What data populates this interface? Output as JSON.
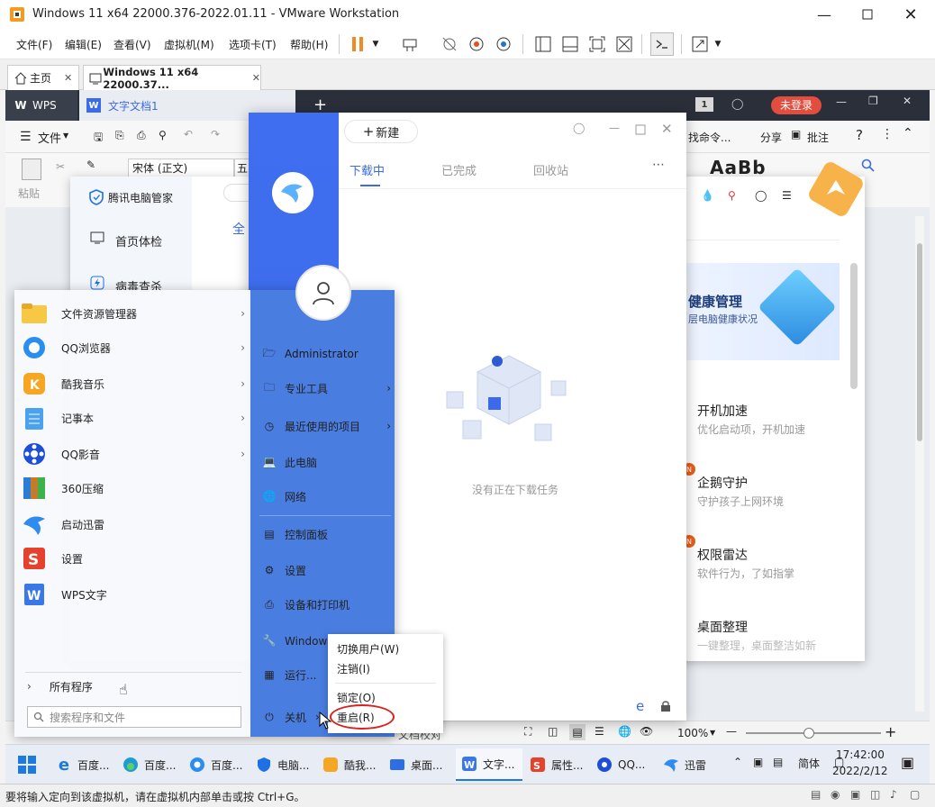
{
  "vmware": {
    "title": "Windows 11 x64 22000.376-2022.01.11 - VMware Workstation",
    "menu": [
      "文件(F)",
      "编辑(E)",
      "查看(V)",
      "虚拟机(M)",
      "选项卡(T)",
      "帮助(H)"
    ],
    "tabs": [
      {
        "label": "主页"
      },
      {
        "label": "Windows 11 x64 22000.37..."
      }
    ],
    "status": "要将输入定向到该虚拟机，请在虚拟机内部单击或按 Ctrl+G。"
  },
  "wps": {
    "app_tab": "WPS",
    "doc_tab": "文字文档1",
    "login": "未登录",
    "file_menu": "文件",
    "font_name": "宋体 (正文)",
    "font_size": "五",
    "paste": "粘贴",
    "find_cmd": "找命令...",
    "share": "分享",
    "annotate": "批注",
    "style_preview": "AaBb",
    "proofread": "文档校对",
    "zoom": "100%"
  },
  "tencent": {
    "app_name": "腾讯电脑管家",
    "nav": [
      "首页体检",
      "病毒查杀"
    ],
    "tab_partial": "全",
    "banner_title": "健康管理",
    "banner_sub": "层电脑健康状况",
    "features": [
      {
        "title": "开机加速",
        "desc": "优化启动项，开机加速"
      },
      {
        "title": "企鹅守护",
        "desc": "守护孩子上网环境"
      },
      {
        "title": "权限雷达",
        "desc": "软件行为，了如指掌"
      },
      {
        "title": "桌面整理",
        "desc": "一键整理，桌面整洁如新"
      }
    ]
  },
  "start_menu": {
    "apps": [
      "文件资源管理器",
      "QQ浏览器",
      "酷我音乐",
      "记事本",
      "QQ影音",
      "360压缩",
      "启动迅雷",
      "设置",
      "WPS文字"
    ],
    "all_programs": "所有程序",
    "search_placeholder": "搜索程序和文件",
    "right_items": [
      "Administrator",
      "专业工具",
      "最近使用的项目",
      "此电脑",
      "网络",
      "控制面板",
      "设置",
      "设备和打印机",
      "Windows 工具",
      "运行...",
      "关机"
    ]
  },
  "xunlei": {
    "new_task": "新建",
    "tabs": [
      "下载中",
      "已完成",
      "回收站"
    ],
    "empty_message": "没有正在下载任务"
  },
  "power_submenu": [
    "切换用户(W)",
    "注销(I)",
    "锁定(O)",
    "重启(R)"
  ],
  "taskbar": {
    "items": [
      "百度...",
      "百度...",
      "百度...",
      "电脑...",
      "酷我...",
      "桌面...",
      "文字...",
      "属性...",
      "QQ...",
      "迅雷"
    ],
    "ime": "简体",
    "time": "17:42:00",
    "date": "2022/2/12"
  },
  "colors": {
    "xunlei_blue": "#3b6bea",
    "highlight_red": "#d9211e",
    "wps_dark": "#2b2f3a"
  }
}
